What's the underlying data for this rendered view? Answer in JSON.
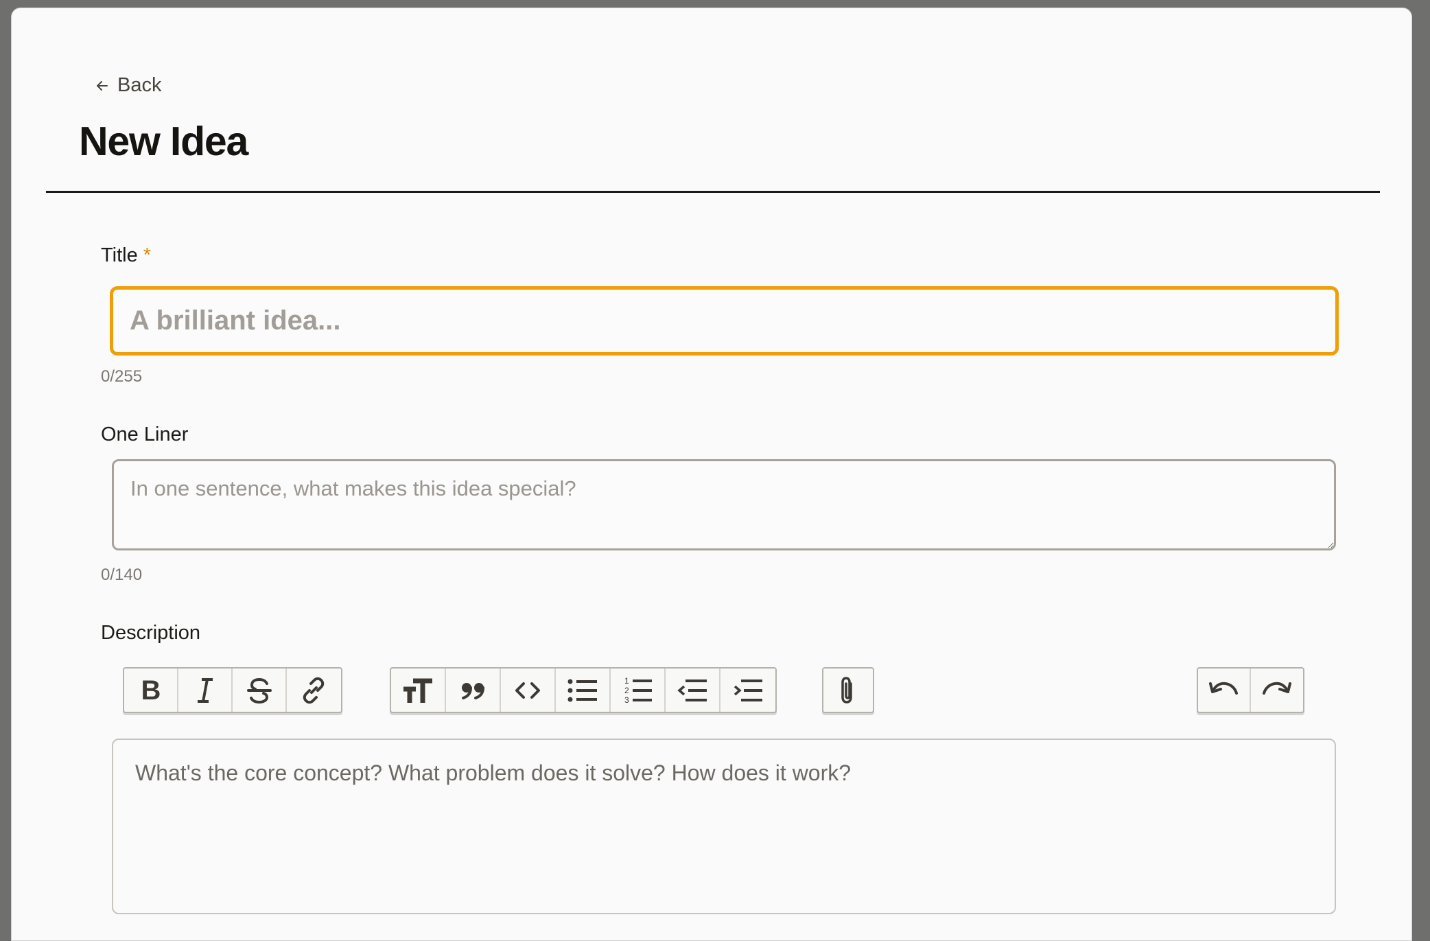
{
  "header": {
    "back_label": "Back",
    "page_title": "New Idea"
  },
  "form": {
    "title": {
      "label": "Title",
      "required_mark": "*",
      "value": "",
      "placeholder": "A brilliant idea...",
      "counter": "0/255"
    },
    "one_liner": {
      "label": "One Liner",
      "value": "",
      "placeholder": "In one sentence, what makes this idea special?",
      "counter": "0/140"
    },
    "description": {
      "label": "Description",
      "placeholder": "What's the core concept? What problem does it solve? How does it work?",
      "toolbar": {
        "text_tools": [
          "bold",
          "italic",
          "strikethrough",
          "link"
        ],
        "block_tools": [
          "heading",
          "quote",
          "code",
          "bullet-list",
          "numbered-list",
          "decrease-indent",
          "increase-indent"
        ],
        "file_tools": [
          "attach-files"
        ],
        "history_tools": [
          "undo",
          "redo"
        ]
      }
    }
  },
  "colors": {
    "accent": "#ef9f08",
    "title_text": "#151411",
    "rule": "#1a1917",
    "background": "#fafafa"
  },
  "icons": [
    "arrow-left-icon",
    "bold-icon",
    "italic-icon",
    "strikethrough-icon",
    "link-icon",
    "heading-icon",
    "quote-icon",
    "code-icon",
    "bullet-list-icon",
    "numbered-list-icon",
    "outdent-icon",
    "indent-icon",
    "paperclip-icon",
    "undo-icon",
    "redo-icon"
  ]
}
